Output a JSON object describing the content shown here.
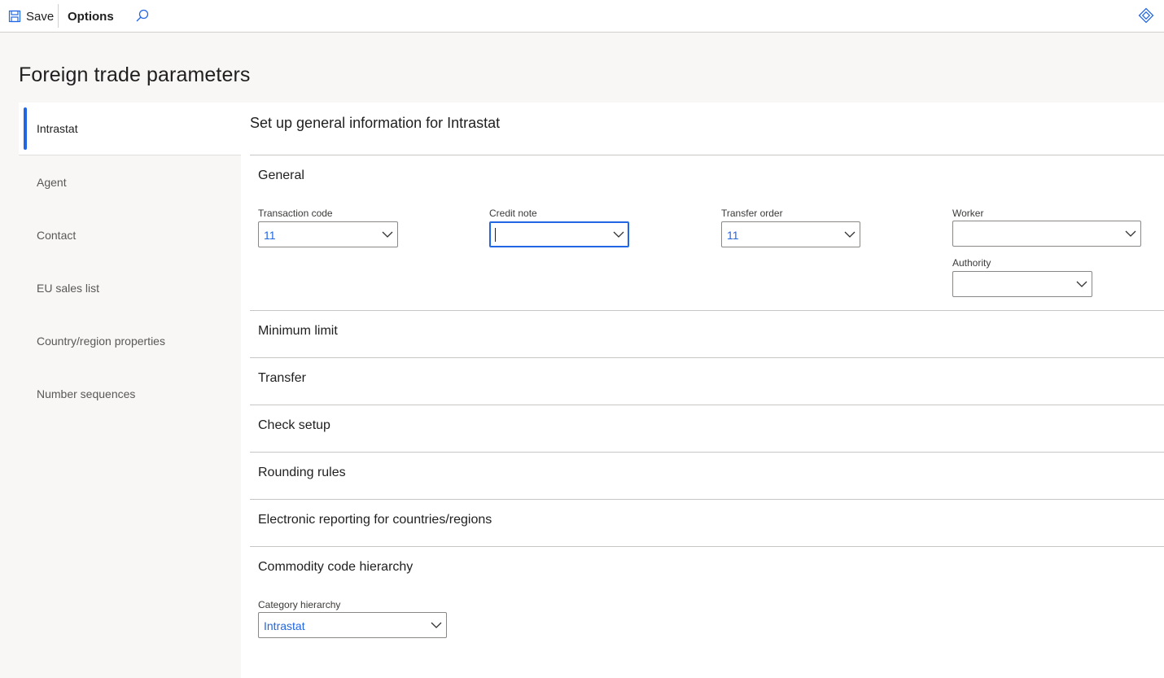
{
  "toolbar": {
    "save_label": "Save",
    "options_label": "Options",
    "icons": [
      "save-icon",
      "search-icon",
      "diamond-icon"
    ]
  },
  "page": {
    "title": "Foreign trade parameters"
  },
  "nav": {
    "items": [
      {
        "label": "Intrastat",
        "active": true
      },
      {
        "label": "Agent"
      },
      {
        "label": "Contact"
      },
      {
        "label": "EU sales list"
      },
      {
        "label": "Country/region properties"
      },
      {
        "label": "Number sequences"
      }
    ]
  },
  "main": {
    "title": "Set up general information for Intrastat",
    "general": {
      "heading": "General",
      "transaction_code": {
        "label": "Transaction code",
        "value": "11"
      },
      "credit_note": {
        "label": "Credit note",
        "value": ""
      },
      "transfer_order": {
        "label": "Transfer order",
        "value": "11"
      },
      "worker": {
        "label": "Worker",
        "value": ""
      },
      "authority": {
        "label": "Authority",
        "value": ""
      }
    },
    "sections": {
      "minimum_limit": "Minimum limit",
      "transfer": "Transfer",
      "check_setup": "Check setup",
      "rounding_rules": "Rounding rules",
      "electronic_reporting": "Electronic reporting for countries/regions",
      "commodity_code_hierarchy": "Commodity code hierarchy"
    },
    "commodity": {
      "category_hierarchy": {
        "label": "Category hierarchy",
        "value": "Intrastat"
      }
    }
  },
  "colors": {
    "accent": "#2266e3",
    "page_bg": "#f8f7f6",
    "panel_bg": "#ffffff",
    "divider": "#c8c6c4"
  }
}
